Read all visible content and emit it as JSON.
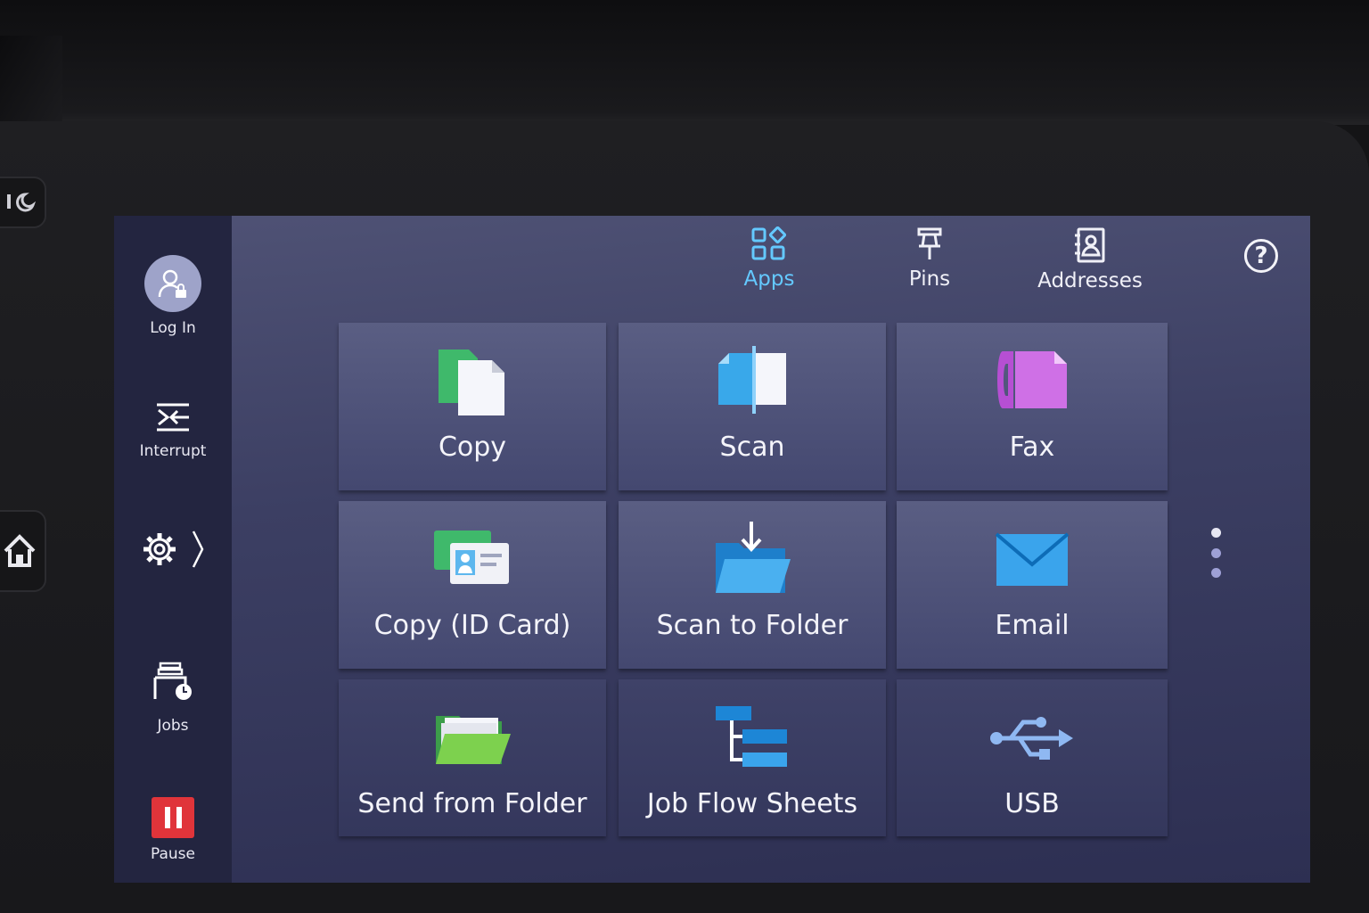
{
  "sidebar": {
    "login_label": "Log In",
    "interrupt_label": "Interrupt",
    "jobs_label": "Jobs",
    "pause_label": "Pause"
  },
  "tabs": [
    {
      "label": "Apps",
      "active": true
    },
    {
      "label": "Pins",
      "active": false
    },
    {
      "label": "Addresses",
      "active": false
    }
  ],
  "tiles": [
    {
      "label": "Copy",
      "icon": "copy-icon"
    },
    {
      "label": "Scan",
      "icon": "scan-icon"
    },
    {
      "label": "Fax",
      "icon": "fax-icon"
    },
    {
      "label": "Copy (ID Card)",
      "icon": "id-card-copy-icon"
    },
    {
      "label": "Scan to Folder",
      "icon": "scan-to-folder-icon"
    },
    {
      "label": "Email",
      "icon": "email-icon"
    },
    {
      "label": "Send from Folder",
      "icon": "send-from-folder-icon"
    },
    {
      "label": "Job Flow Sheets",
      "icon": "job-flow-sheets-icon"
    },
    {
      "label": "USB",
      "icon": "usb-icon"
    }
  ],
  "colors": {
    "active_tab": "#64c9ff",
    "pause_red": "#e0343a",
    "screen_bg": "#3c3f63"
  }
}
